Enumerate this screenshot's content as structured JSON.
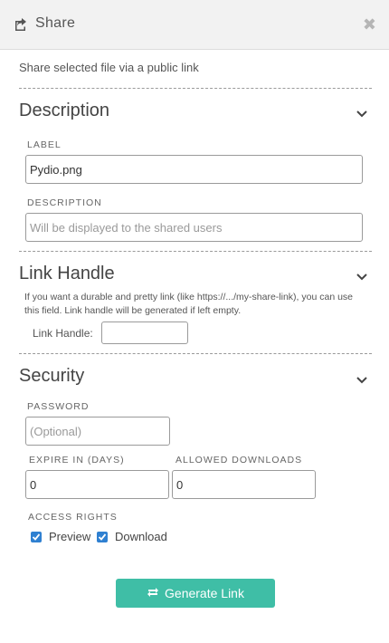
{
  "dialog": {
    "title": "Share",
    "intro": "Share selected file via a public link",
    "icons": {
      "header": "share-icon",
      "close": "close-icon",
      "collapse": "chevron-down-icon",
      "generate": "refresh-icon"
    },
    "colors": {
      "accent": "#3fbea6",
      "checkbox": "#2f80d1",
      "header_bg": "#f2f2f2"
    }
  },
  "description": {
    "title": "Description",
    "label_label": "LABEL",
    "label_value": "Pydio.png",
    "desc_label": "DESCRIPTION",
    "desc_placeholder": "Will be displayed to the shared users"
  },
  "link_handle": {
    "title": "Link Handle",
    "help": "If you want a durable and pretty link (like https://.../my-share-link), you can use this field. Link handle will be generated if left empty.",
    "label": "Link Handle:",
    "value": ""
  },
  "security": {
    "title": "Security",
    "password_label": "PASSWORD",
    "password_placeholder": "(Optional)",
    "expire_label": "EXPIRE IN (DAYS)",
    "expire_value": "0",
    "downloads_label": "ALLOWED DOWNLOADS",
    "downloads_value": "0",
    "rights_label": "ACCESS RIGHTS",
    "preview_label": "Preview",
    "preview_checked": true,
    "download_label": "Download",
    "download_checked": true
  },
  "generate_button": "Generate Link"
}
